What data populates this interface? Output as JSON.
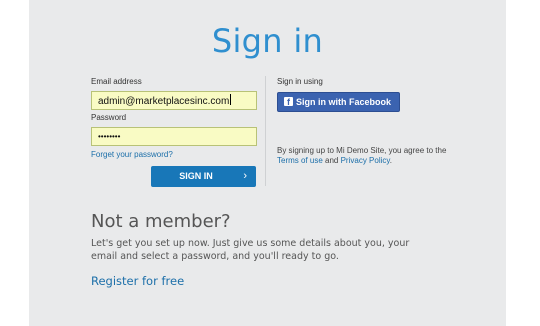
{
  "title": "Sign in",
  "form": {
    "email_label": "Email address",
    "email_value": "admin@marketplacesinc.com",
    "password_label": "Password",
    "password_value": "••••••••",
    "forgot_link": "Forget your password?",
    "signin_button": "SIGN IN",
    "signin_chevron": "›"
  },
  "social": {
    "heading": "Sign in using",
    "facebook_icon": "f",
    "facebook_button": "Sign in with Facebook",
    "terms_prefix": "By signing up to Mi Demo Site, you agree to the ",
    "terms_link": "Terms of use",
    "terms_and": " and ",
    "privacy_link": "Privacy Policy",
    "terms_suffix": "."
  },
  "register": {
    "heading": "Not a member?",
    "description": "Let's get you set up now. Just give us some details about you, your email and select a password, and you'll ready to go.",
    "link": "Register for free"
  },
  "colors": {
    "accent": "#2f8fcf",
    "button": "#1877b8",
    "facebook": "#3b63b0",
    "input_bg": "#f9fbc4",
    "panel_bg": "#e9eaeb"
  }
}
